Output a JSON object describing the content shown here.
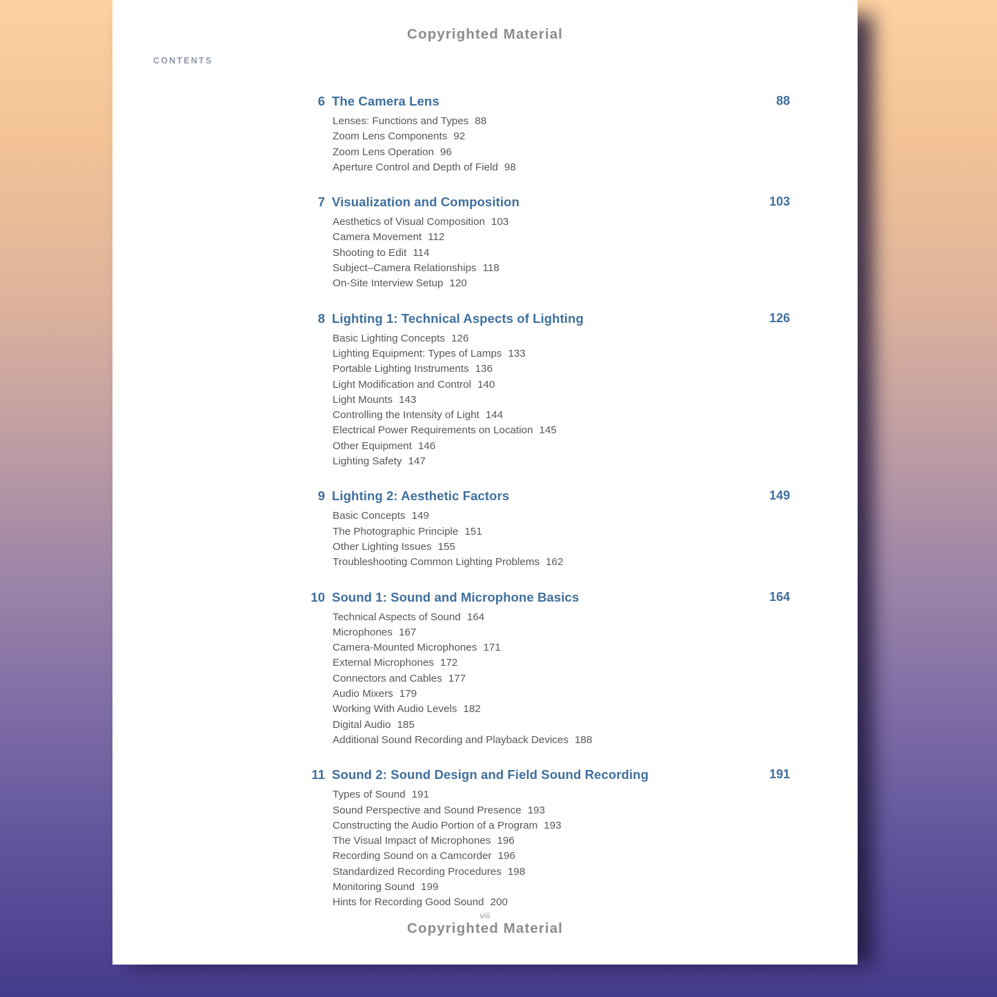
{
  "page": {
    "header_mark": "Copyrighted Material",
    "footer_mark": "Copyrighted Material",
    "folio": "viii",
    "section_label": "CONTENTS",
    "accent_color": "#3f6f9e",
    "body_text_color": "#54585c",
    "watermark_color": "#8b8b8b",
    "background_top_color": "#fdd1a0",
    "background_bottom_color": "#453b8c"
  },
  "chapters": [
    {
      "number": "6",
      "title": "The Camera Lens",
      "page": "88",
      "entries": [
        {
          "title": "Lenses: Functions and Types",
          "page": "88"
        },
        {
          "title": "Zoom Lens Components",
          "page": "92"
        },
        {
          "title": "Zoom Lens Operation",
          "page": "96"
        },
        {
          "title": "Aperture Control and Depth of Field",
          "page": "98"
        }
      ]
    },
    {
      "number": "7",
      "title": "Visualization and Composition",
      "page": "103",
      "entries": [
        {
          "title": "Aesthetics of Visual Composition",
          "page": "103"
        },
        {
          "title": "Camera Movement",
          "page": "112"
        },
        {
          "title": "Shooting to Edit",
          "page": "114"
        },
        {
          "title": "Subject–Camera Relationships",
          "page": "118"
        },
        {
          "title": "On-Site Interview Setup",
          "page": "120"
        }
      ]
    },
    {
      "number": "8",
      "title": "Lighting 1: Technical Aspects of Lighting",
      "page": "126",
      "entries": [
        {
          "title": "Basic Lighting Concepts",
          "page": "126"
        },
        {
          "title": "Lighting Equipment: Types of Lamps",
          "page": "133"
        },
        {
          "title": "Portable Lighting Instruments",
          "page": "136"
        },
        {
          "title": "Light Modification and Control",
          "page": "140"
        },
        {
          "title": "Light Mounts",
          "page": "143"
        },
        {
          "title": "Controlling the Intensity of Light",
          "page": "144"
        },
        {
          "title": "Electrical Power Requirements on Location",
          "page": "145"
        },
        {
          "title": "Other Equipment",
          "page": "146"
        },
        {
          "title": "Lighting Safety",
          "page": "147"
        }
      ]
    },
    {
      "number": "9",
      "title": "Lighting 2: Aesthetic Factors",
      "page": "149",
      "entries": [
        {
          "title": "Basic Concepts",
          "page": "149"
        },
        {
          "title": "The Photographic Principle",
          "page": "151"
        },
        {
          "title": "Other Lighting Issues",
          "page": "155"
        },
        {
          "title": "Troubleshooting Common Lighting Problems",
          "page": "162"
        }
      ]
    },
    {
      "number": "10",
      "title": "Sound 1: Sound and Microphone Basics",
      "page": "164",
      "entries": [
        {
          "title": "Technical Aspects of Sound",
          "page": "164"
        },
        {
          "title": "Microphones",
          "page": "167"
        },
        {
          "title": "Camera-Mounted Microphones",
          "page": "171"
        },
        {
          "title": "External Microphones",
          "page": "172"
        },
        {
          "title": "Connectors and Cables",
          "page": "177"
        },
        {
          "title": "Audio Mixers",
          "page": "179"
        },
        {
          "title": "Working With Audio Levels",
          "page": "182"
        },
        {
          "title": "Digital Audio",
          "page": "185"
        },
        {
          "title": "Additional Sound Recording and Playback Devices",
          "page": "188"
        }
      ]
    },
    {
      "number": "11",
      "title": "Sound 2: Sound Design and Field Sound Recording",
      "page": "191",
      "entries": [
        {
          "title": "Types of Sound",
          "page": "191"
        },
        {
          "title": "Sound Perspective and Sound Presence",
          "page": "193"
        },
        {
          "title": "Constructing the Audio Portion of a Program",
          "page": "193"
        },
        {
          "title": "The Visual Impact of Microphones",
          "page": "196"
        },
        {
          "title": "Recording Sound on a Camcorder",
          "page": "196"
        },
        {
          "title": "Standardized Recording Procedures",
          "page": "198"
        },
        {
          "title": "Monitoring Sound",
          "page": "199"
        },
        {
          "title": "Hints for Recording Good Sound",
          "page": "200"
        }
      ]
    }
  ]
}
